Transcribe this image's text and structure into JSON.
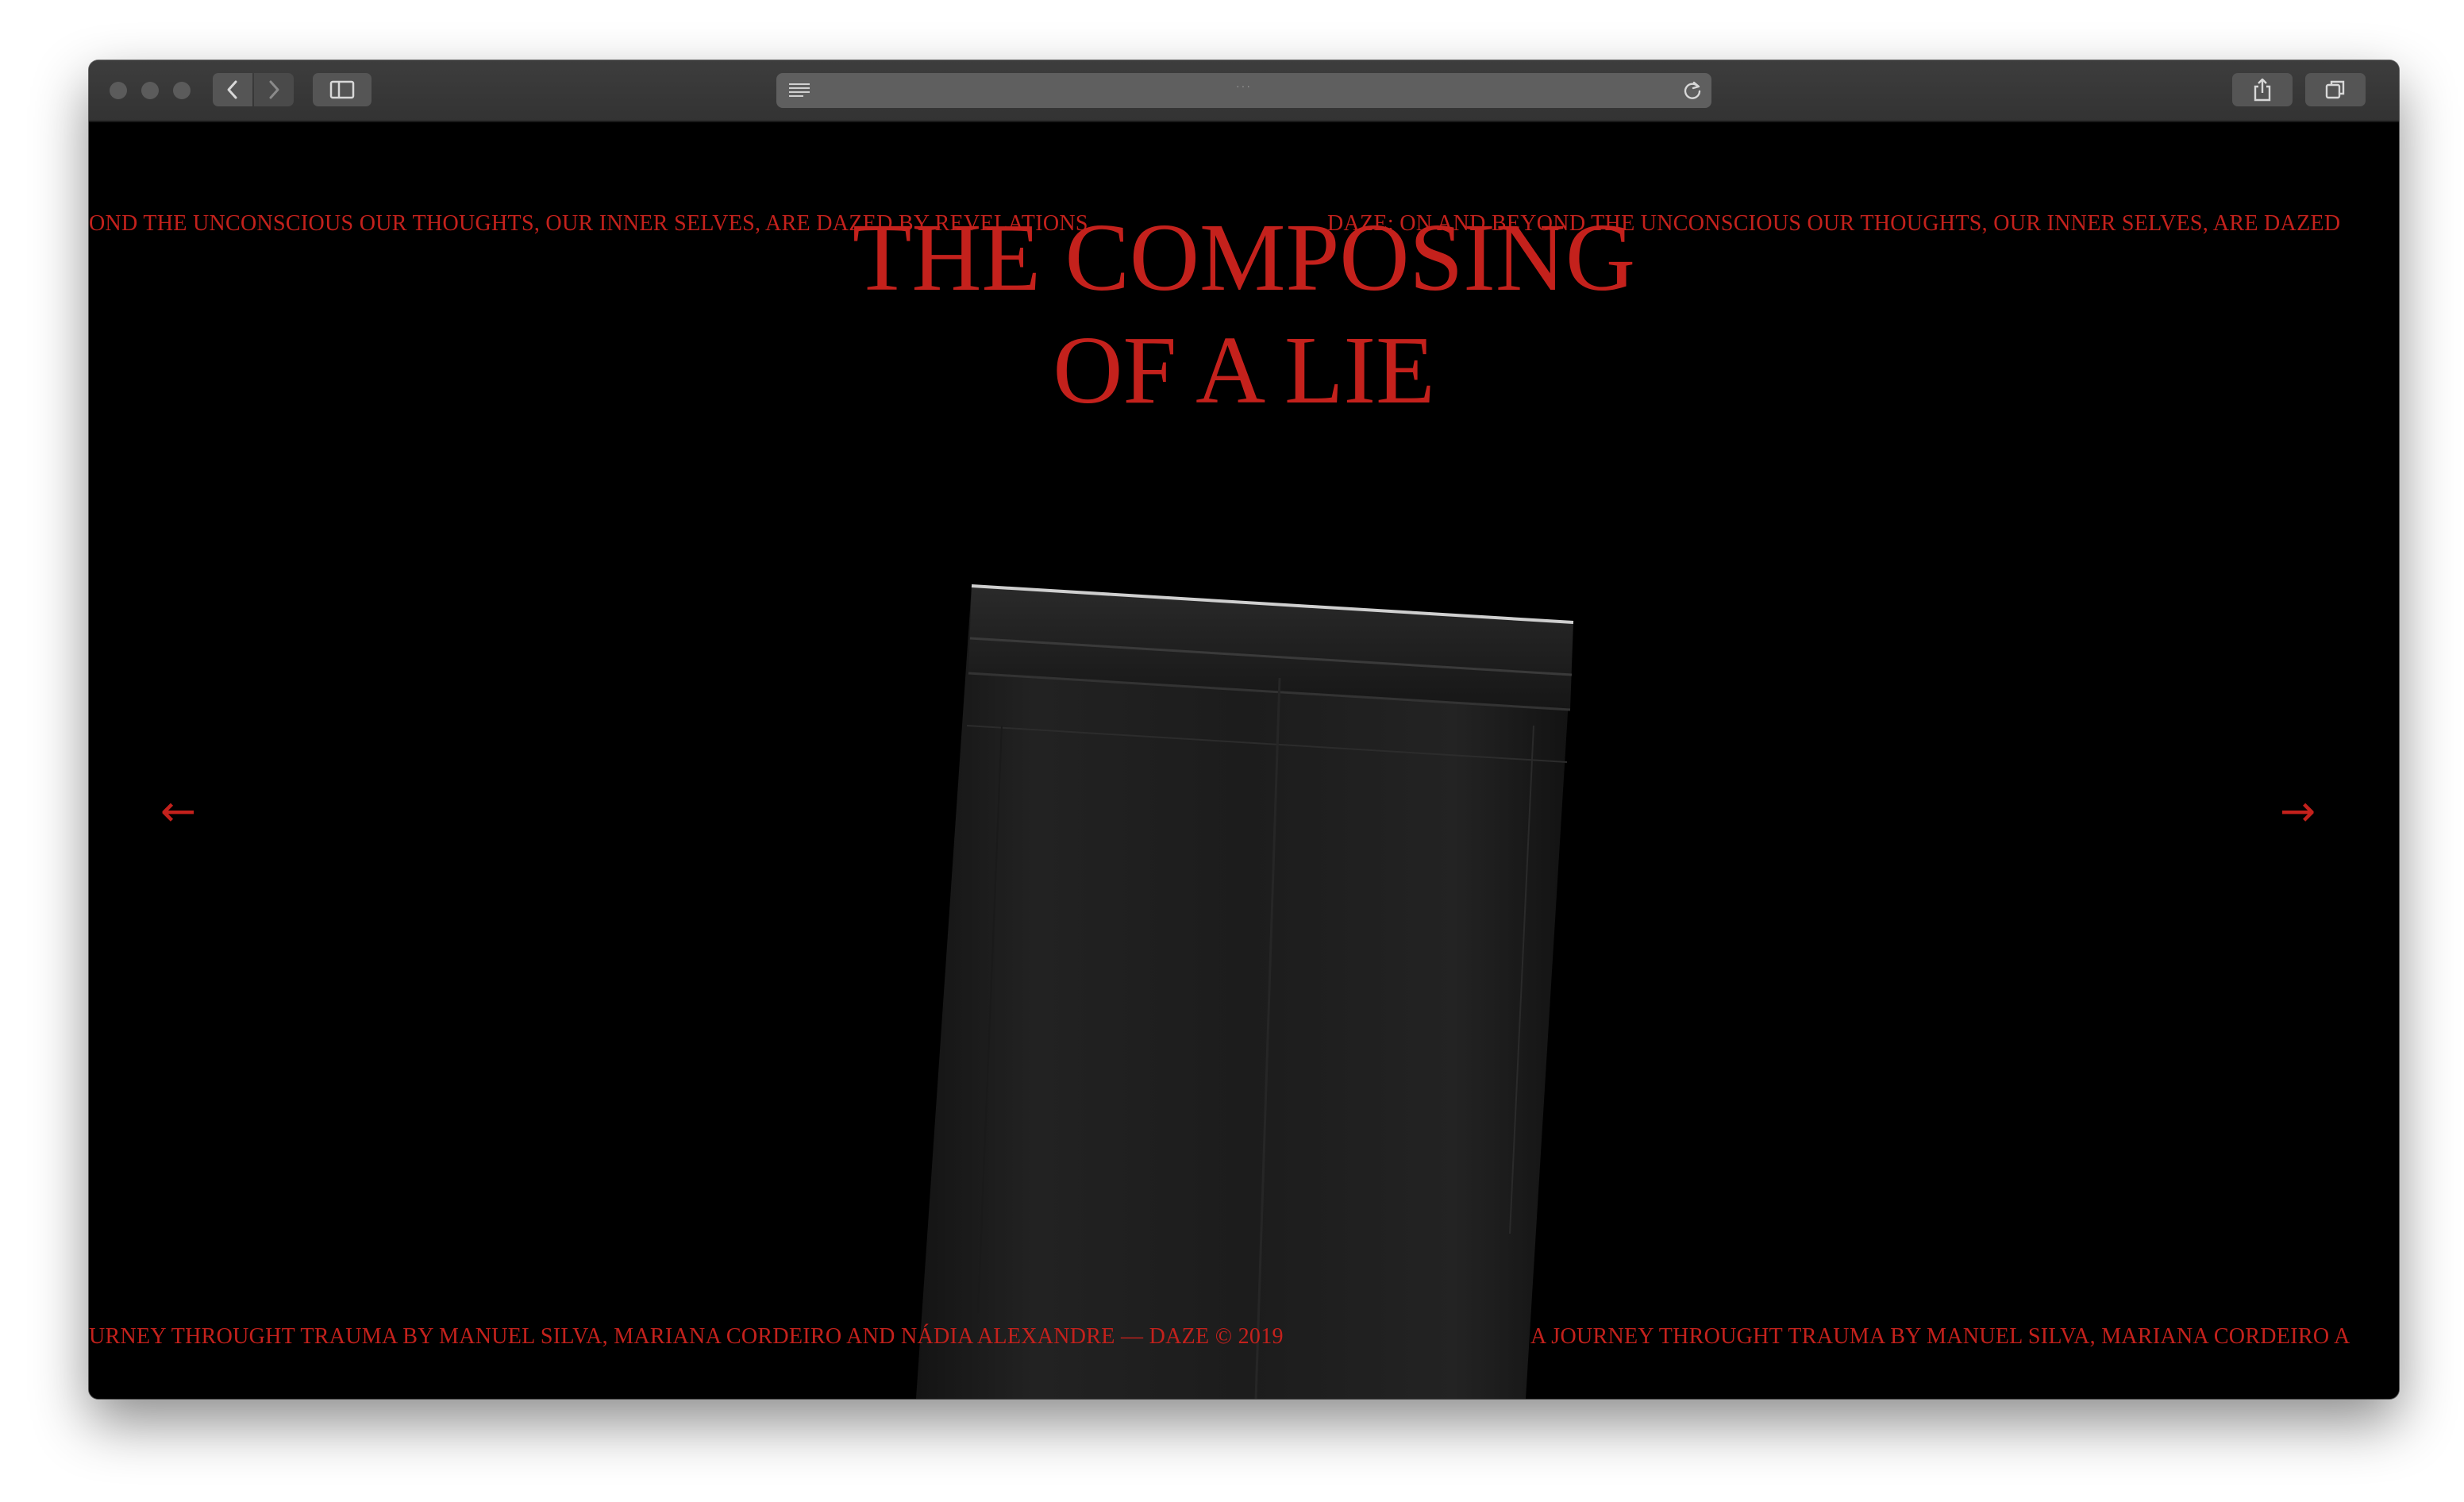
{
  "browser": {
    "url_text": "···",
    "icons": {
      "back": "chevron-left-icon",
      "forward": "chevron-right-icon",
      "sidebar": "sidebar-icon",
      "reader": "reader-lines-icon",
      "reload": "reload-icon",
      "share": "share-icon",
      "tabs": "tabs-icon"
    }
  },
  "page": {
    "top_ticker_left": "OND THE UNCONSCIOUS OUR THOUGHTS, OUR INNER SELVES, ARE DAZED BY REVELATIONS.",
    "top_ticker_right": "DAZE: ON AND BEYOND THE UNCONSCIOUS OUR THOUGHTS, OUR INNER SELVES, ARE DAZED",
    "title_line1": "THE COMPOSING",
    "title_line2": "OF A LIE",
    "prev_arrow": "←",
    "next_arrow": "→",
    "bottom_ticker_left": "URNEY THROUGHT TRAUMA BY MANUEL SILVA, MARIANA CORDEIRO AND NÁDIA ALEXANDRE — DAZE © 2019",
    "bottom_ticker_right": "A JOURNEY THROUGHT TRAUMA BY MANUEL SILVA, MARIANA CORDEIRO A"
  },
  "colors": {
    "accent_red": "#c4211c",
    "background": "#000000",
    "toolbar": "#383838"
  }
}
